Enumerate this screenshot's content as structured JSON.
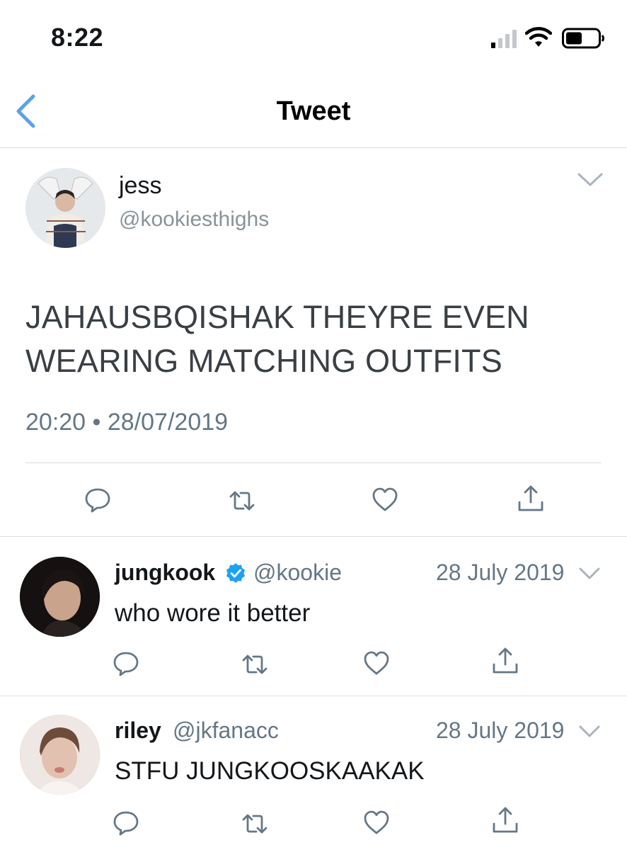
{
  "status_bar": {
    "time": "8:22"
  },
  "nav": {
    "title": "Tweet"
  },
  "main_tweet": {
    "author_name": "jess",
    "author_handle": "@kookiesthighs",
    "text_line1": "JAHAUSBQISHAK THEYRE EVEN",
    "text_line2": "WEARING MATCHING OUTFITS",
    "timestamp": "20:20 • 28/07/2019",
    "actions": [
      "reply-icon",
      "retweet-icon",
      "like-icon",
      "share-icon"
    ]
  },
  "replies": [
    {
      "author_name": "jungkook",
      "verified": true,
      "author_handle": "@kookie",
      "date": "28 July 2019",
      "text": "who wore it better"
    },
    {
      "author_name": "riley",
      "verified": false,
      "author_handle": "@jkfanacc",
      "date": "28 July 2019",
      "text": "STFU JUNGKOOSKAAKAK"
    }
  ],
  "colors": {
    "accent": "#1da1f2",
    "back_arrow": "#5aa3e6",
    "secondary_text": "#657786",
    "icon_gray": "#657786",
    "divider": "#d8dde2"
  }
}
